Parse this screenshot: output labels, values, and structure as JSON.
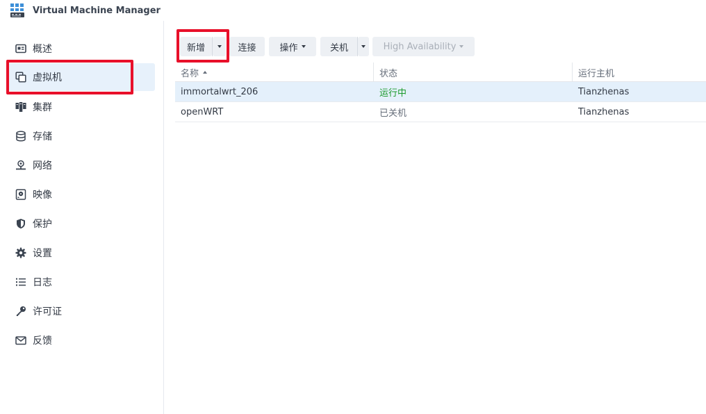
{
  "app": {
    "title": "Virtual Machine Manager"
  },
  "sidebar": {
    "items": [
      {
        "label": "概述",
        "icon": "overview-icon"
      },
      {
        "label": "虚拟机",
        "icon": "virtual-machine-icon",
        "active": true
      },
      {
        "label": "集群",
        "icon": "cluster-icon"
      },
      {
        "label": "存储",
        "icon": "storage-icon"
      },
      {
        "label": "网络",
        "icon": "network-icon"
      },
      {
        "label": "映像",
        "icon": "image-icon"
      },
      {
        "label": "保护",
        "icon": "shield-icon"
      },
      {
        "label": "设置",
        "icon": "gear-icon"
      },
      {
        "label": "日志",
        "icon": "log-list-icon"
      },
      {
        "label": "许可证",
        "icon": "key-icon"
      },
      {
        "label": "反馈",
        "icon": "mail-icon"
      }
    ]
  },
  "toolbar": {
    "create_label": "新增",
    "connect_label": "连接",
    "action_label": "操作",
    "shutdown_label": "关机",
    "ha_label": "High Availability"
  },
  "table": {
    "columns": [
      "名称",
      "状态",
      "运行主机"
    ],
    "rows": [
      {
        "name": "immortalwrt_206",
        "status": "运行中",
        "host": "Tianzhenas"
      },
      {
        "name": "openWRT",
        "status": "已关机",
        "host": "Tianzhenas"
      }
    ]
  },
  "colors": {
    "accent_selected": "#e4f0fb",
    "status_running": "#1b9a2b",
    "annotation_red": "#e8102a"
  }
}
